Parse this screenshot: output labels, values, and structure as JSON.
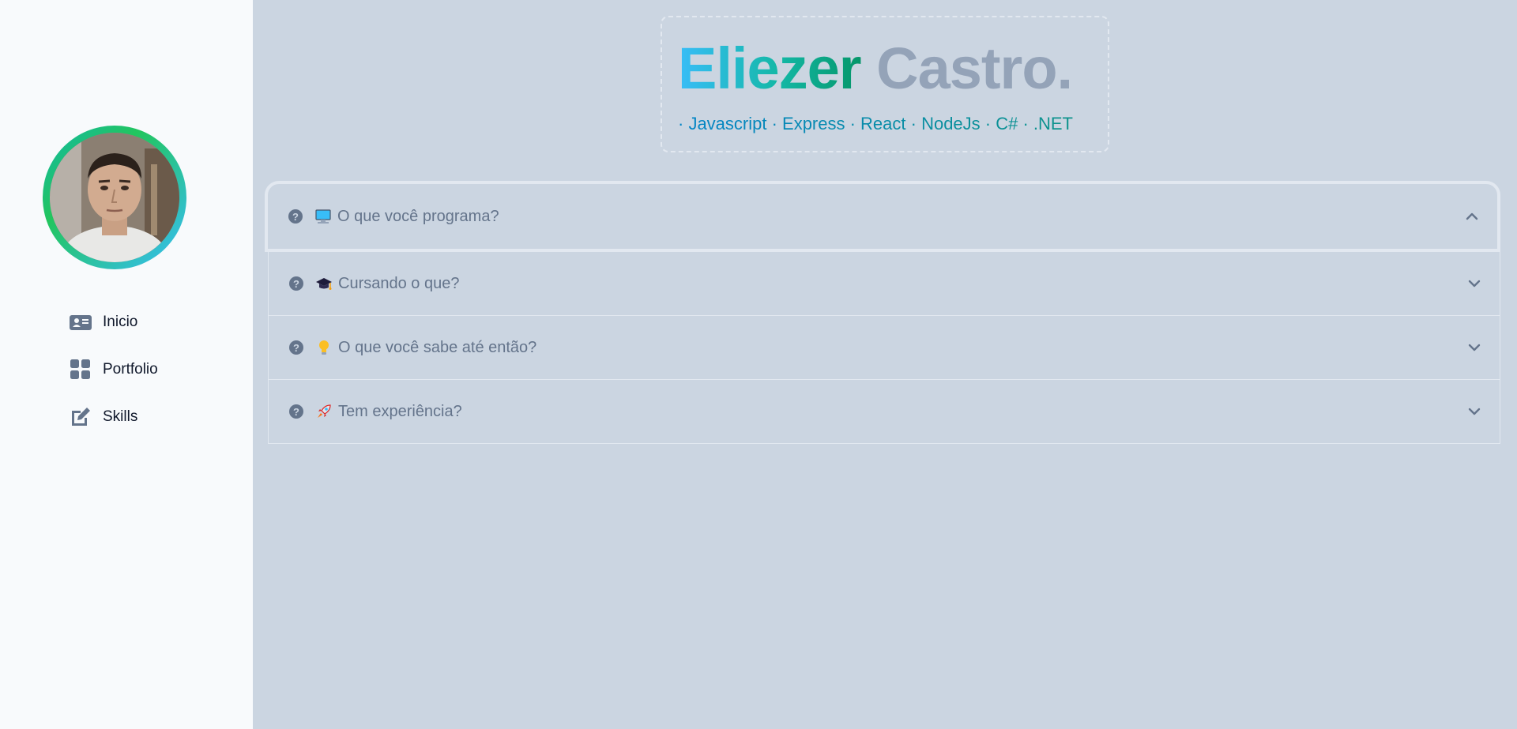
{
  "header": {
    "first_name": "Eliezer",
    "last_name": "Castro.",
    "skills_line": "· Javascript · Express · React · NodeJs · C# · .NET"
  },
  "sidebar": {
    "items": [
      {
        "label": "Inicio",
        "icon": "id-card-icon"
      },
      {
        "label": "Portfolio",
        "icon": "grid-icon"
      },
      {
        "label": "Skills",
        "icon": "pen-to-square-icon"
      }
    ]
  },
  "accordion": {
    "items": [
      {
        "label": "O que você programa?",
        "emoji": "computer-icon",
        "expanded": true
      },
      {
        "label": "Cursando o que?",
        "emoji": "graduation-cap-icon",
        "expanded": false
      },
      {
        "label": "O que você sabe até então?",
        "emoji": "light-bulb-icon",
        "expanded": false
      },
      {
        "label": "Tem experiência?",
        "emoji": "rocket-icon",
        "expanded": false
      }
    ]
  },
  "colors": {
    "sidebar_bg": "#f8fafc",
    "main_bg": "#cbd5e1",
    "accent_teal": "#14b8a6",
    "accent_sky": "#38bdf8",
    "muted_text": "#64748b"
  }
}
